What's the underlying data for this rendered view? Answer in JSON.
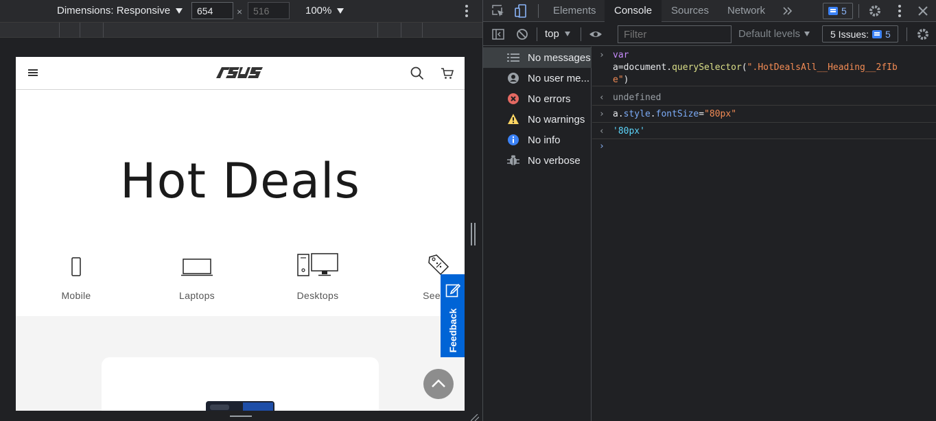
{
  "emulator": {
    "dimensions_label": "Dimensions: Responsive",
    "width_value": "654",
    "height_value": "516",
    "times": "×",
    "zoom": "100%"
  },
  "page": {
    "logo": "/ISUS",
    "title": "Hot Deals",
    "categories": [
      "Mobile",
      "Laptops",
      "Desktops",
      "See All"
    ],
    "feedback": "Feedback"
  },
  "devtools": {
    "tabs": [
      "Elements",
      "Console",
      "Sources",
      "Network"
    ],
    "active_tab": "Console",
    "issues_count": "5",
    "context": "top",
    "filter_placeholder": "Filter",
    "levels": "Default levels",
    "issues_label": "5 Issues:",
    "issues_label_count": "5",
    "sidebar": [
      {
        "label": "No messages",
        "icon": "list-icon"
      },
      {
        "label": "No user me...",
        "icon": "user-icon"
      },
      {
        "label": "No errors",
        "icon": "error-icon"
      },
      {
        "label": "No warnings",
        "icon": "warning-icon"
      },
      {
        "label": "No info",
        "icon": "info-icon"
      },
      {
        "label": "No verbose",
        "icon": "bug-icon"
      }
    ],
    "console": {
      "l1_kw": "var",
      "l1_a": "a=document.",
      "l1_fn": "querySelector",
      "l1_open": "(",
      "l1_str": "\".HotDealsAll__Heading__2fIb",
      "l1_str2": "e\"",
      "l1_close": ")",
      "r1": "undefined",
      "l2_a": "a.",
      "l2_prop1": "style",
      "l2_dot": ".",
      "l2_prop2": "fontSize",
      "l2_eq": "=",
      "l2_str": "\"80px\"",
      "r2": "'80px'"
    }
  }
}
